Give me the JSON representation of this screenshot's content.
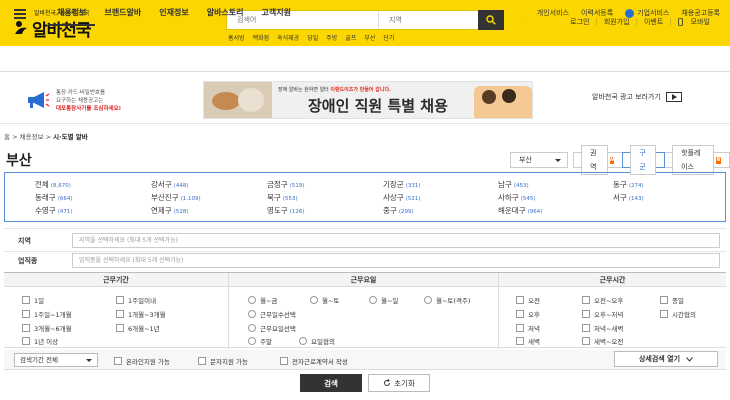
{
  "header": {
    "slogan": "알바천국, 쓸수록 천국",
    "brand": "알바천국",
    "search_placeholder": "검색어",
    "location_placeholder": "지역",
    "quick_tags": [
      "홈서빙",
      "백화점",
      "숙식제공",
      "당일",
      "주방",
      "골프",
      "부산",
      "단기"
    ],
    "top_links": [
      "로그인",
      "회원가입",
      "이벤트",
      "모바일"
    ]
  },
  "nav": {
    "items": [
      "채용정보",
      "브랜드알바",
      "인재정보",
      "알바스토리",
      "고객지원"
    ],
    "right": [
      "개인서비스",
      "이력서등록",
      "기업서비스",
      "채용공고등록"
    ]
  },
  "ads": {
    "left_lines": [
      "통장·카드·비밀번호를",
      "요구하는 채용공고는",
      "대포통장사기를 조심하세요!"
    ],
    "banner_small_pre": "장애 알바는 원하면 일터",
    "banner_small_hl": "이랜드이츠가 만들어 갑니다.",
    "banner_big": "장애인 직원 특별 채용",
    "promo_link": "알바천국 광고 보러가기"
  },
  "breadcrumb": {
    "home": "홈",
    "sep": ">",
    "path1": "채용정보",
    "current": "시·도별 알바"
  },
  "page_title": "부산",
  "region_select": "부산",
  "mode_tabs": [
    {
      "label": "권역",
      "badge": "N"
    },
    {
      "label": "구군",
      "badge": ""
    },
    {
      "label": "핫플레이스",
      "badge": "N"
    }
  ],
  "districts": [
    {
      "name": "전체",
      "count": "(8,670)"
    },
    {
      "name": "강서구",
      "count": "(448)"
    },
    {
      "name": "금정구",
      "count": "(519)"
    },
    {
      "name": "기장군",
      "count": "(331)"
    },
    {
      "name": "남구",
      "count": "(453)"
    },
    {
      "name": "동구",
      "count": "(274)"
    },
    {
      "name": "동래구",
      "count": "(664)"
    },
    {
      "name": "부산진구",
      "count": "(1,109)"
    },
    {
      "name": "북구",
      "count": "(553)"
    },
    {
      "name": "사상구",
      "count": "(521)"
    },
    {
      "name": "사하구",
      "count": "(545)"
    },
    {
      "name": "서구",
      "count": "(143)"
    },
    {
      "name": "수영구",
      "count": "(471)"
    },
    {
      "name": "연제구",
      "count": "(528)"
    },
    {
      "name": "영도구",
      "count": "(126)"
    },
    {
      "name": "중구",
      "count": "(299)"
    },
    {
      "name": "해운대구",
      "count": "(964)"
    }
  ],
  "form": {
    "region_label": "지역",
    "region_placeholder": "지역을 선택하세요 (최대 5개 선택가능)",
    "job_label": "업직종",
    "job_placeholder": "업직종을 선택하세요 (최대 5개 선택가능)"
  },
  "filters": {
    "period_title": "근무기간",
    "period": [
      "1일",
      "1주일이내",
      "1주일~1개월",
      "1개월~3개월",
      "3개월~6개월",
      "6개월~1년",
      "1년 이상"
    ],
    "days_title": "근무요일",
    "days": [
      "월~금",
      "월~토",
      "월~일",
      "월~토(격주)",
      "근무일수선택",
      "근무요일선택",
      "주말",
      "요일협의"
    ],
    "time_title": "근무시간",
    "time": [
      "오전",
      "오전~오후",
      "종일",
      "오후",
      "오후~저녁",
      "시간협의",
      "저녁",
      "저녁~새벽",
      "새벽",
      "새벽~오전"
    ]
  },
  "bottom": {
    "period_select": "검색기간 전체",
    "options": [
      "온라인지원 가능",
      "문자지원 가능",
      "전자근로계약서 작성"
    ],
    "detail_button": "상세검색 열기",
    "search_button": "검색",
    "reset_button": "초기화"
  },
  "colors": {
    "brand_yellow": "#fbd600",
    "accent_blue": "#2b6cd0",
    "badge_orange": "#ff6a00"
  }
}
